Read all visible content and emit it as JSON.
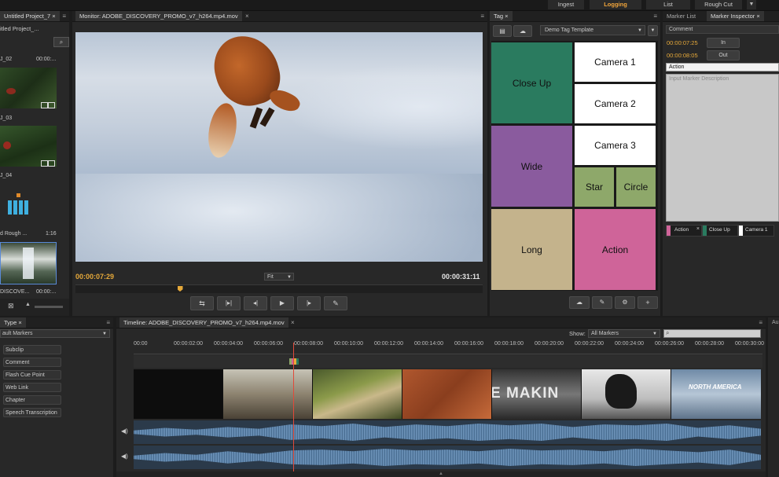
{
  "workspaces": [
    "Ingest",
    "Logging",
    "List",
    "Rough Cut"
  ],
  "active_workspace": "Logging",
  "project": {
    "tab": "Untitled Project_7",
    "subtitle": "itled Project_...",
    "items": [
      {
        "name": "J_02",
        "time": "00:00:..."
      },
      {
        "name": "J_03",
        "time": ""
      },
      {
        "name": "J_04",
        "time": ""
      },
      {
        "name": "d Rough ...",
        "time": "1:16"
      },
      {
        "name": "DISCOVE...",
        "time": "00:00:..."
      }
    ]
  },
  "monitor": {
    "tab": "Monitor: ADOBE_DISCOVERY_PROMO_v7_h264.mp4.mov",
    "current_time": "00:00:07:29",
    "duration": "00:00:31:11",
    "zoom": "Fit",
    "playhead_percent": 25
  },
  "tag_panel": {
    "tab": "Tag",
    "template": "Demo Tag Template",
    "tiles": [
      {
        "label": "Close Up",
        "color": "#2a7b5f"
      },
      {
        "label": "Camera 1",
        "color": "#ffffff"
      },
      {
        "label": "Camera 2",
        "color": "#ffffff"
      },
      {
        "label": "Wide",
        "color": "#8a5b9e"
      },
      {
        "label": "Camera 3",
        "color": "#ffffff"
      },
      {
        "label": "Star",
        "color": "#8ea86a"
      },
      {
        "label": "Circle",
        "color": "#8ea86a"
      },
      {
        "label": "Long",
        "color": "#c4b38c"
      },
      {
        "label": "Action",
        "color": "#cf6499"
      }
    ]
  },
  "marker_inspector": {
    "tabs": [
      "Marker List",
      "Marker Inspector"
    ],
    "comment_label": "Comment",
    "in_time": "00:00:07:25",
    "in_label": "In",
    "out_time": "00:00:08:05",
    "out_label": "Out",
    "name_value": "Action",
    "description_placeholder": "Input Marker Description",
    "tags": [
      {
        "label": "Action",
        "color": "#cf6499"
      },
      {
        "label": "Close Up",
        "color": "#2a7b5f"
      },
      {
        "label": "Camera 1",
        "color": "#ffffff"
      }
    ]
  },
  "marker_types": {
    "tab": "Type",
    "dropdown": "ault Markers",
    "items": [
      "Subclip",
      "Comment",
      "Flash Cue Point",
      "Web Link",
      "Chapter",
      "Speech Transcription"
    ]
  },
  "timeline": {
    "tab": "Timeline: ADOBE_DISCOVERY_PROMO_v7_h264.mp4.mov",
    "show_label": "Show:",
    "show_value": "All Markers",
    "ticks": [
      "00:00",
      "00:00:02:00",
      "00:00:04:00",
      "00:00:06:00",
      "00:00:08:00",
      "00:00:10:00",
      "00:00:12:00",
      "00:00:14:00",
      "00:00:16:00",
      "00:00:18:00",
      "00:00:20:00",
      "00:00:22:00",
      "00:00:24:00",
      "00:00:26:00",
      "00:00:28:00",
      "00:00:30:00"
    ],
    "thumb_texts": [
      "E MAKIN",
      "NORTH AMERICA"
    ]
  },
  "far_right_tab": "Au"
}
